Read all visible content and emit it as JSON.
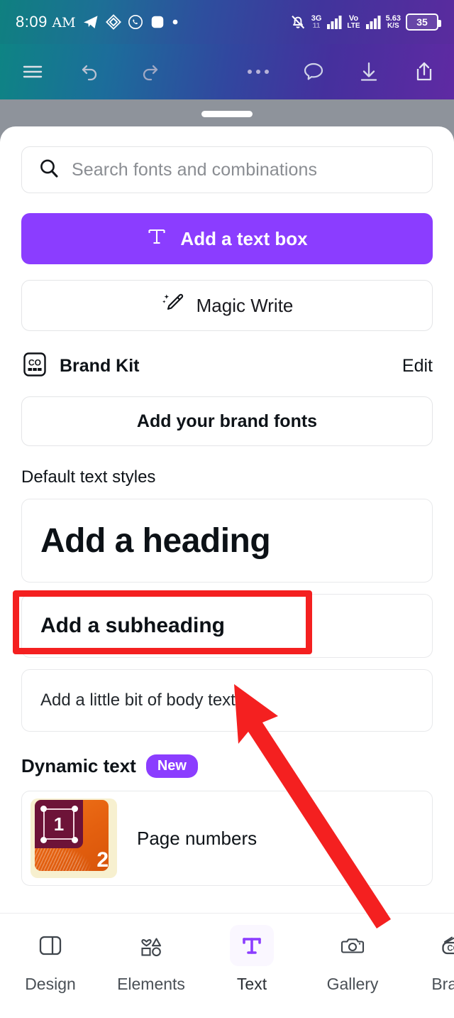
{
  "status_bar": {
    "time": "8:09",
    "ampm": "AM",
    "icons": [
      "telegram-icon",
      "notes-icon",
      "whatsapp-icon",
      "square-app-icon",
      "dot-icon"
    ],
    "silent_icon": "bell-off-icon",
    "network_1": {
      "tech": "3G",
      "bars_label": "11"
    },
    "network_2": {
      "tech": "Vo",
      "sub": "LTE"
    },
    "data_rate": {
      "value": "5.63",
      "unit": "K/S"
    },
    "battery_percent": "35"
  },
  "toolbar": {
    "menu_label": "hamburger-menu",
    "undo_label": "undo",
    "redo_label": "redo",
    "more_label": "more-options",
    "comment_label": "comment",
    "download_label": "download",
    "share_label": "share"
  },
  "search": {
    "placeholder": "Search fonts and combinations",
    "icon": "search-icon"
  },
  "primary_actions": {
    "add_text_box": "Add a text box",
    "add_text_box_icon": "text-T-icon",
    "add_text_box_color": "#8b3dff",
    "magic_write": "Magic Write",
    "magic_write_icon": "magic-pencil-icon"
  },
  "brand_kit": {
    "icon": "brand-kit-co-icon",
    "title": "Brand Kit",
    "edit_label": "Edit",
    "add_brand_fonts": "Add your brand fonts"
  },
  "default_text_styles": {
    "title": "Default text styles",
    "items": [
      {
        "label": "Add a heading",
        "style": "heading"
      },
      {
        "label": "Add a subheading",
        "style": "subheading"
      },
      {
        "label": "Add a little bit of body text",
        "style": "body"
      }
    ]
  },
  "dynamic_text": {
    "title": "Dynamic text",
    "badge": "New",
    "badge_color": "#8b3dff",
    "items": [
      {
        "label": "Page numbers",
        "thumb_page_a": "1",
        "thumb_page_b": "2"
      }
    ]
  },
  "bottom_nav": {
    "items": [
      {
        "label": "Design",
        "icon": "layout-panel-icon",
        "active": false
      },
      {
        "label": "Elements",
        "icon": "shapes-icon",
        "active": false
      },
      {
        "label": "Text",
        "icon": "text-T-icon",
        "active": true
      },
      {
        "label": "Gallery",
        "icon": "camera-icon",
        "active": false
      },
      {
        "label": "Brand",
        "icon": "brand-kit-co-icon",
        "active": false
      }
    ]
  },
  "annotations": {
    "highlight_target": "Add a subheading",
    "highlight_color": "#f42020",
    "arrow_color": "#f42020",
    "arrow_tip": "330,963",
    "arrow_tail": "548,1300"
  }
}
